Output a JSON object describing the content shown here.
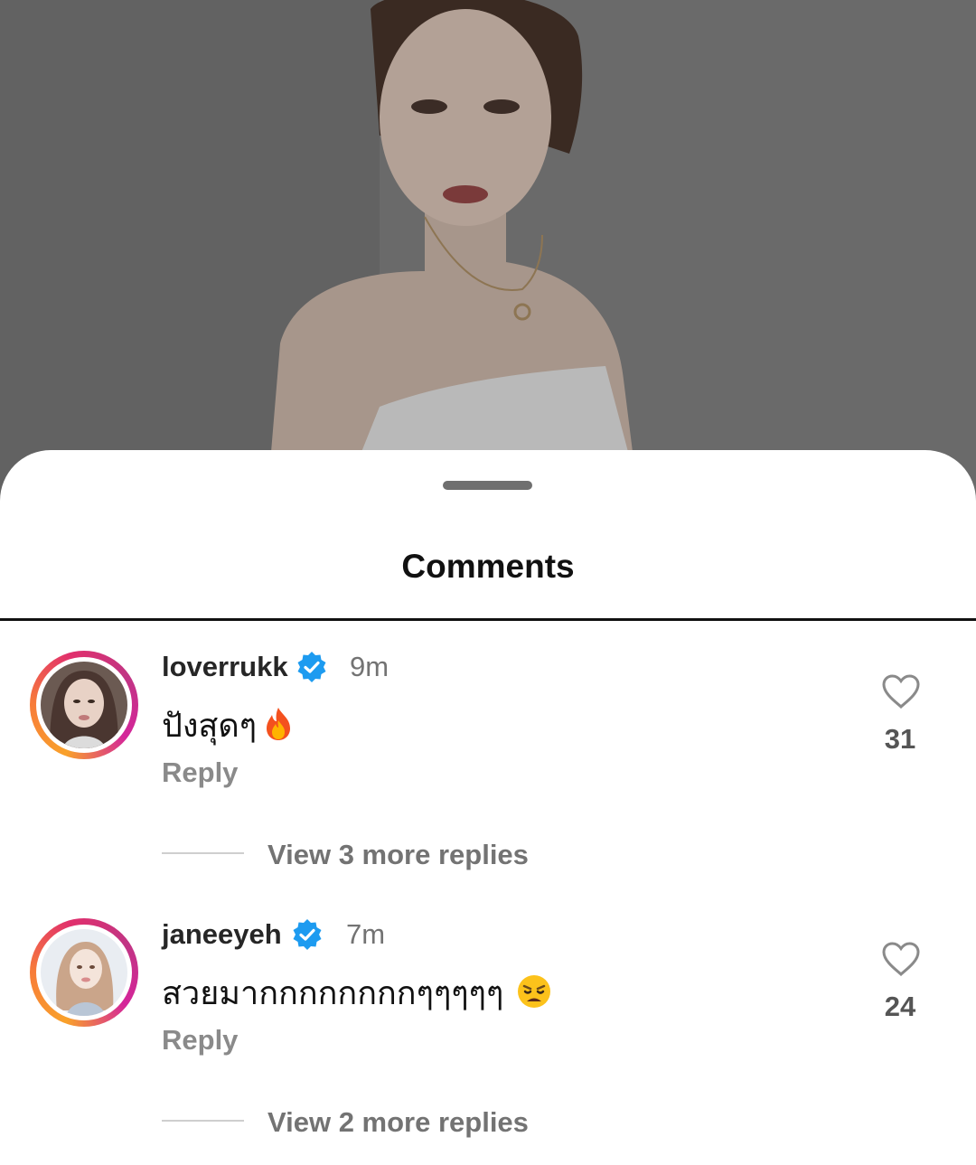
{
  "sheet": {
    "title": "Comments"
  },
  "comments": [
    {
      "username": "loverrukk",
      "verified": true,
      "time": "9m",
      "text": "ปังสุดๆ",
      "emoji": "fire-emoji",
      "reply_label": "Reply",
      "likes": "31",
      "view_replies": "View 3 more replies"
    },
    {
      "username": "janeeyeh",
      "verified": true,
      "time": "7m",
      "text": "สวยมากกกกกกกกๆๆๆๆๆ",
      "emoji": "weary-face-emoji",
      "reply_label": "Reply",
      "likes": "24",
      "view_replies": "View 2 more replies"
    }
  ],
  "colors": {
    "verified_blue": "#1d9bf0",
    "text_primary": "#111111",
    "text_secondary": "#737373"
  },
  "icons": [
    "heart-outline-icon",
    "verified-badge-icon",
    "drag-handle"
  ]
}
